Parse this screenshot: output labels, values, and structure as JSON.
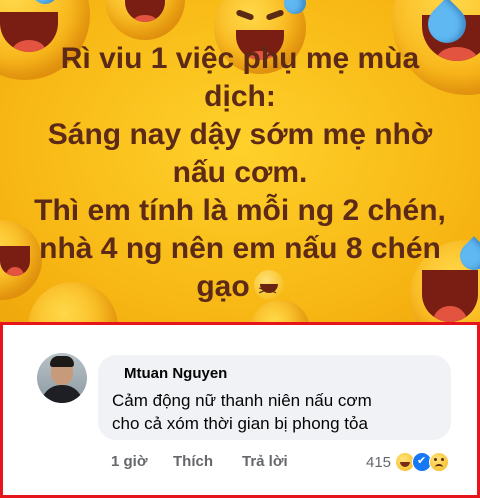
{
  "post": {
    "caption_lines": [
      "Rì viu 1 việc phụ mẹ mùa",
      "dịch:",
      "Sáng nay dậy sớm mẹ nhờ",
      "nấu cơm.",
      "Thì em tính là mỗi ng 2 chén,",
      "nhà 4 ng nên em nấu 8 chén",
      "gạo"
    ],
    "background_color": "#f7b613",
    "text_color": "#5c2a17",
    "emoji_icon": "laughing-face-icon"
  },
  "comment": {
    "author": "Mtuan Nguyen",
    "text_line1": "Cảm động nữ thanh niên nấu cơm",
    "text_line2": "cho cả xóm thời gian bị phong tỏa",
    "time": "1 giờ",
    "like_label": "Thích",
    "reply_label": "Trả lời",
    "reaction_count": "415",
    "reactions": [
      "haha-reaction-icon",
      "like-reaction-icon",
      "sad-reaction-icon"
    ],
    "highlight_color": "#e5151b"
  }
}
